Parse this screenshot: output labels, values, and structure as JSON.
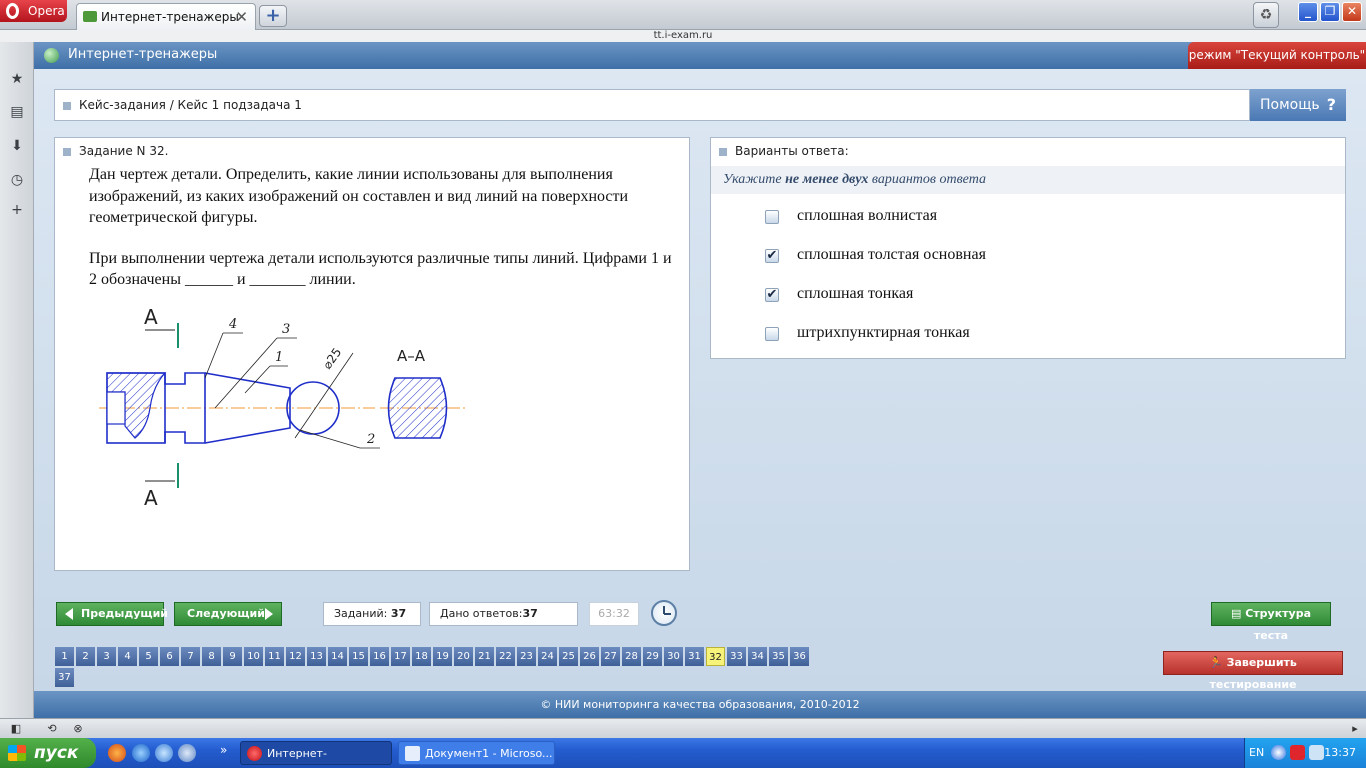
{
  "browser": {
    "menu_label": "Opera",
    "tab_title": "Интернет-тренажеры",
    "address": "tt.i-exam.ru"
  },
  "header": {
    "title": "Интернет-тренажеры",
    "mode": "режим \"Текущий контроль\""
  },
  "breadcrumb": "Кейс-задания / Кейс 1 подзадача 1",
  "help_label": "Помощь",
  "task": {
    "heading": "Задание N 32.",
    "paragraph1": "Дан чертеж детали. Определить, какие линии использованы для выполнения изображений, из каких изображений он составлен и вид линий на поверхности геометрической фигуры.",
    "paragraph2": "При выполнении чертежа детали используются различные типы линий. Цифрами 1 и 2 обозначены ______ и _______ линии.",
    "drawing_labels": {
      "cut_top": "A",
      "cut_bottom": "A",
      "section": "A–A",
      "leader1": "1",
      "leader2": "2",
      "leader3": "3",
      "leader4": "4",
      "diameter": "⌀25"
    }
  },
  "answers": {
    "heading": "Варианты ответа:",
    "instruction_pre": "Укажите",
    "instruction_bold": "не менее двух",
    "instruction_post": "вариантов ответа",
    "options": [
      {
        "label": "сплошная волнистая",
        "checked": false,
        "mark": ""
      },
      {
        "label": "сплошная толстая основная",
        "checked": true,
        "mark": "✔"
      },
      {
        "label": "сплошная тонкая",
        "checked": true,
        "mark": "✔"
      },
      {
        "label": "штрихпунктирная тонкая",
        "checked": false,
        "mark": ""
      }
    ]
  },
  "nav": {
    "prev_label": "Предыдущий",
    "next_label": "Следующий",
    "tasks_label": "Заданий:",
    "tasks_count": "37",
    "answered_label": "Дано ответов:",
    "answered_count": "37",
    "timer": "63:32",
    "structure_label": "Структура теста",
    "finish_label": "Завершить тестирование",
    "current_question": 32,
    "question_numbers": [
      "1",
      "2",
      "3",
      "4",
      "5",
      "6",
      "7",
      "8",
      "9",
      "10",
      "11",
      "12",
      "13",
      "14",
      "15",
      "16",
      "17",
      "18",
      "19",
      "20",
      "21",
      "22",
      "23",
      "24",
      "25",
      "26",
      "27",
      "28",
      "29",
      "30",
      "31",
      "32",
      "33",
      "34",
      "35",
      "36",
      "37"
    ]
  },
  "footer": "© НИИ мониторинга качества образования, 2010-2012",
  "taskbar": {
    "start_label": "пуск",
    "more_glyph": "»",
    "items": [
      {
        "label": "Интернет-тренажер...",
        "active": true
      },
      {
        "label": "Документ1 - Microso...",
        "active": false
      }
    ],
    "lang": "EN",
    "time": "13:37"
  },
  "colors": {
    "header_blue": "#3e6fa7",
    "green_button": "#2f8a36",
    "red_button": "#b8322c",
    "current_question": "#f6f27a",
    "drawing_blue": "#1f2ec9",
    "axis_orange": "#f39a3a",
    "leader_black": "#222222"
  }
}
